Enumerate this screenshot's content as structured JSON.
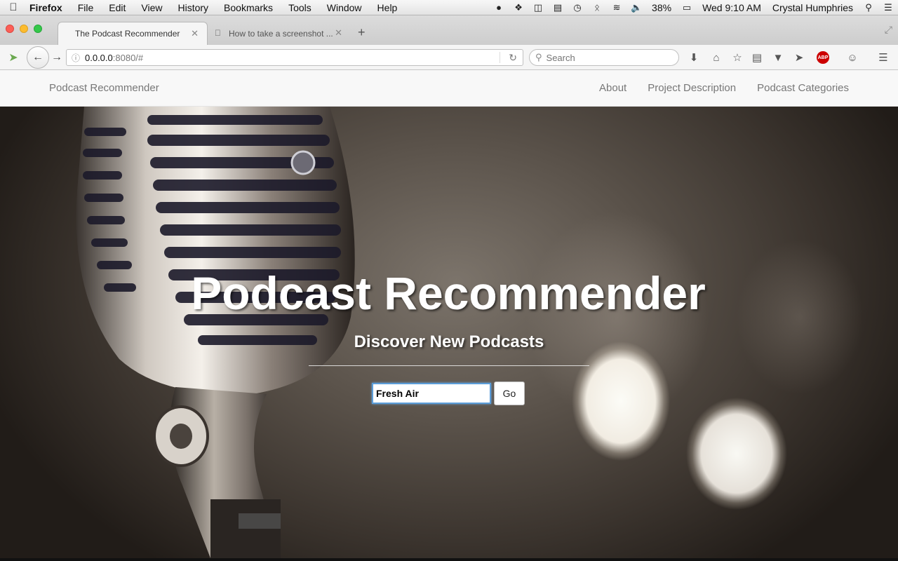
{
  "menubar": {
    "app": "Firefox",
    "items": [
      "File",
      "Edit",
      "View",
      "History",
      "Bookmarks",
      "Tools",
      "Window",
      "Help"
    ],
    "battery": "38%",
    "clock": "Wed 9:10 AM",
    "user": "Crystal Humphries"
  },
  "tabs": [
    {
      "title": "The Podcast Recommender",
      "active": true
    },
    {
      "title": "How to take a screenshot ...",
      "active": false
    }
  ],
  "toolbar": {
    "url_host": "0.0.0.0",
    "url_path": ":8080/#",
    "search_placeholder": "Search"
  },
  "site": {
    "brand": "Podcast Recommender",
    "nav": [
      "About",
      "Project Description",
      "Podcast Categories"
    ]
  },
  "hero": {
    "title": "Podcast Recommender",
    "subtitle": "Discover New Podcasts",
    "search_value": "Fresh Air",
    "go_label": "Go"
  }
}
